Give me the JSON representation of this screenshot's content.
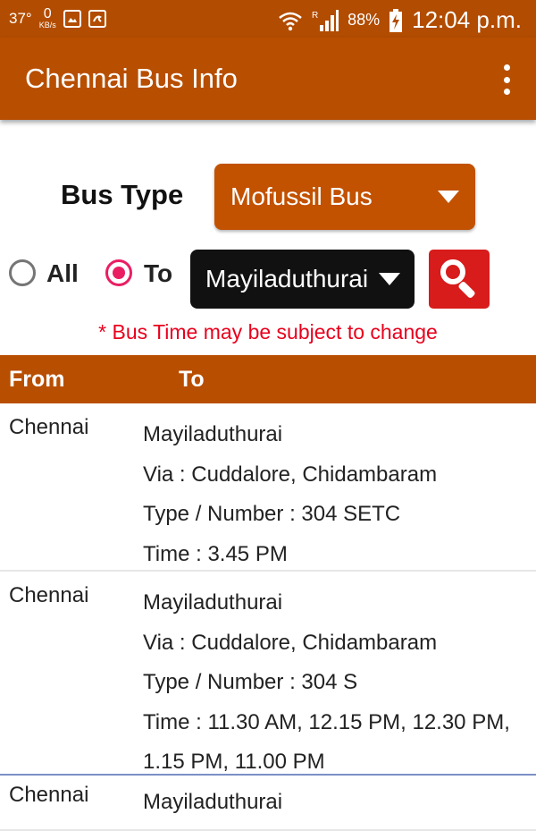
{
  "status_bar": {
    "temperature": "37°",
    "net_speed": "0",
    "net_unit": "KB/s",
    "battery": "88%",
    "time": "12:04 p.m.",
    "icons": [
      "image-icon",
      "app-notification-icon",
      "wifi-icon",
      "signal-icon",
      "battery-icon"
    ]
  },
  "app_bar": {
    "title": "Chennai Bus Info",
    "menu_icon": "overflow-menu-icon"
  },
  "filter": {
    "bus_type_label": "Bus Type",
    "bus_type_value": "Mofussil Bus",
    "radio_all_label": "All",
    "radio_to_label": "To",
    "selected_radio": "To",
    "destination_value": "Mayiladuthurai",
    "search_icon": "search-icon",
    "notice": "* Bus Time may be subject to change"
  },
  "table": {
    "headers": {
      "from": "From",
      "to": "To"
    },
    "rows": [
      {
        "from": "Chennai",
        "to": "Mayiladuthurai",
        "via": "Via : Cuddalore, Chidambaram",
        "type_number": "Type / Number :  304 SETC",
        "time": "Time : 3.45 PM"
      },
      {
        "from": "Chennai",
        "to": "Mayiladuthurai",
        "via": "Via : Cuddalore, Chidambaram",
        "type_number": "Type / Number :  304 S",
        "time": "Time : 11.30 AM,  12.15 PM,  12.30 PM,  1.15 PM,  11.00 PM"
      },
      {
        "from": "Chennai",
        "to": "Mayiladuthurai"
      }
    ]
  },
  "colors": {
    "primary": "#b84e00",
    "status_bar": "#b24c00",
    "search_button": "#d81b1b",
    "radio_accent": "#e91e63",
    "notice_text": "#e8001c"
  }
}
